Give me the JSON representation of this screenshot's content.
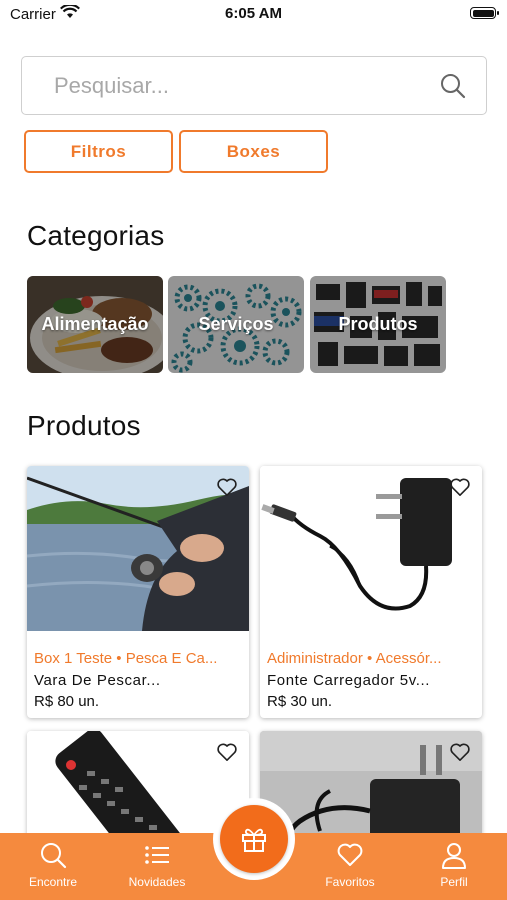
{
  "status_bar": {
    "carrier": "Carrier",
    "time": "6:05 AM"
  },
  "search": {
    "placeholder": "Pesquisar..."
  },
  "buttons": {
    "filters": "Filtros",
    "boxes": "Boxes"
  },
  "categories_section": {
    "title": "Categorias",
    "items": [
      {
        "label": "Alimentação"
      },
      {
        "label": "Serviços"
      },
      {
        "label": "Produtos"
      }
    ]
  },
  "products_section": {
    "title": "Produtos",
    "items": [
      {
        "category": "Box 1 Teste • Pesca E Ca...",
        "name": "Vara De Pescar...",
        "price": "R$ 80 un."
      },
      {
        "category": "Adiministrador • Acessór...",
        "name": "Fonte Carregador 5v...",
        "price": "R$ 30 un."
      },
      {
        "category": "",
        "name": "",
        "price": ""
      },
      {
        "category": "",
        "name": "",
        "price": ""
      }
    ]
  },
  "tab_bar": {
    "items": [
      {
        "label": "Encontre",
        "icon": "search-icon"
      },
      {
        "label": "Novidades",
        "icon": "list-icon"
      },
      {
        "label": "Favoritos",
        "icon": "heart-icon"
      },
      {
        "label": "Perfil",
        "icon": "user-icon"
      }
    ],
    "center_icon": "gift-icon"
  },
  "colors": {
    "accent": "#f07a2c",
    "tab_bar": "#f58a3e",
    "fab": "#f26c1b"
  }
}
